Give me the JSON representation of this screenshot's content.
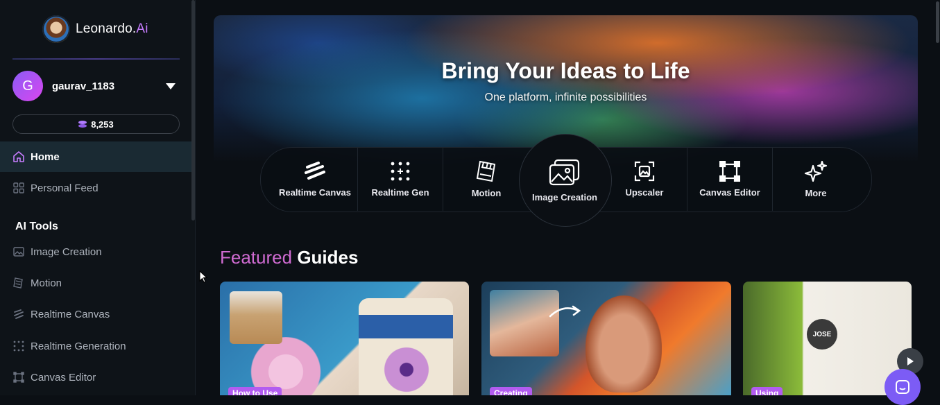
{
  "brand": {
    "name": "Leonardo.",
    "name_accent": "Ai"
  },
  "user": {
    "initial": "G",
    "name": "gaurav_1183"
  },
  "credits": {
    "amount": "8,253"
  },
  "nav": {
    "home": "Home",
    "personal_feed": "Personal Feed",
    "section_title": "AI Tools",
    "tools": [
      {
        "label": "Image Creation",
        "icon": "image-icon"
      },
      {
        "label": "Motion",
        "icon": "film-icon"
      },
      {
        "label": "Realtime Canvas",
        "icon": "brush-icon"
      },
      {
        "label": "Realtime Generation",
        "icon": "grid-dots-icon"
      },
      {
        "label": "Canvas Editor",
        "icon": "canvas-icon"
      }
    ]
  },
  "hero": {
    "title": "Bring Your Ideas to Life",
    "subtitle": "One platform, infinite possibilities",
    "tools": [
      {
        "label": "Realtime Canvas"
      },
      {
        "label": "Realtime Gen"
      },
      {
        "label": "Motion"
      },
      {
        "label": "Image Creation"
      },
      {
        "label": "Upscaler"
      },
      {
        "label": "Canvas Editor"
      },
      {
        "label": "More"
      }
    ]
  },
  "guides": {
    "heading_accent": "Featured",
    "heading": "Guides",
    "cards": [
      {
        "badge": "How to Use"
      },
      {
        "badge": "Creating"
      },
      {
        "badge": "Using",
        "logo_text": "JOSE"
      }
    ]
  },
  "colors": {
    "accent": "#c77dff",
    "active_nav_bg": "#1a2a33",
    "badge": "#b25cf0",
    "chat": "#7c5cf5"
  }
}
